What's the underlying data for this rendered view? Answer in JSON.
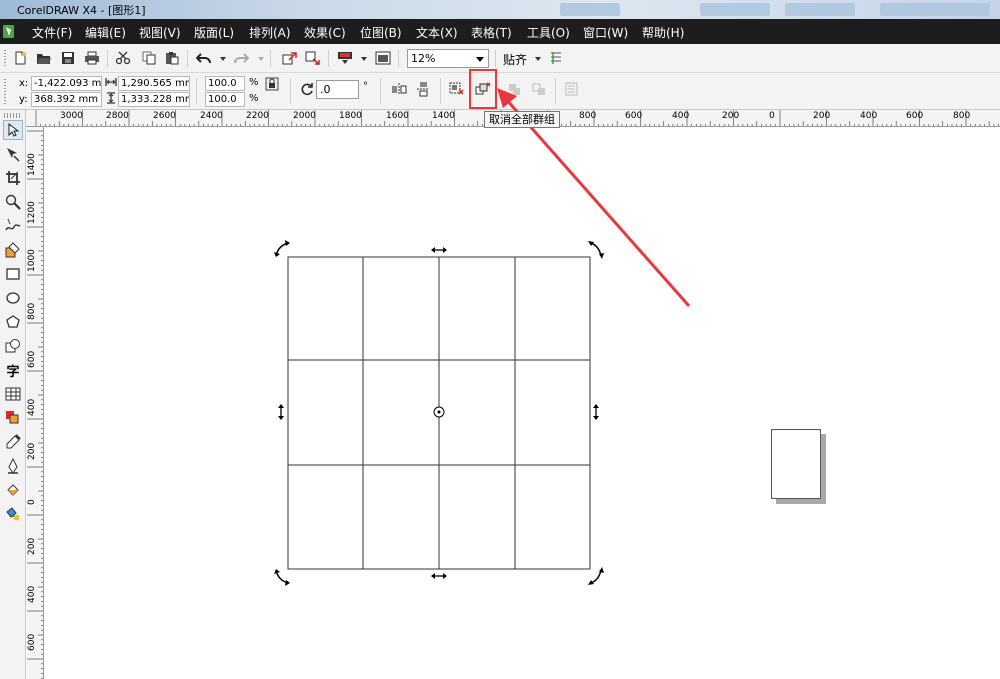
{
  "window": {
    "title": "CorelDRAW X4 - [图形1]"
  },
  "menu": [
    {
      "label": "文件(F)"
    },
    {
      "label": "编辑(E)"
    },
    {
      "label": "视图(V)"
    },
    {
      "label": "版面(L)"
    },
    {
      "label": "排列(A)"
    },
    {
      "label": "效果(C)"
    },
    {
      "label": "位图(B)"
    },
    {
      "label": "文本(X)"
    },
    {
      "label": "表格(T)"
    },
    {
      "label": "工具(O)"
    },
    {
      "label": "窗口(W)"
    },
    {
      "label": "帮助(H)"
    }
  ],
  "standard_toolbar": {
    "zoom_value": "12%",
    "snap_label": "贴齐",
    "icons": [
      "new-icon",
      "open-icon",
      "save-icon",
      "print-icon",
      "cut-icon",
      "copy-icon",
      "paste-icon",
      "undo-icon",
      "redo-icon",
      "import-icon",
      "export-icon",
      "application-launcher-icon",
      "welcome-screen-icon",
      "snap-options-icon"
    ]
  },
  "property_bar": {
    "x_label": "x:",
    "x_value": "-1,422.093 mm",
    "y_label": "y:",
    "y_value": "368.392 mm",
    "width_value": "1,290.565 mm",
    "height_value": "1,333.228 mm",
    "scale_x": "100.0",
    "scale_y": "100.0",
    "percent_sign": "%",
    "rotation_value": ".0",
    "degree_sign": "°"
  },
  "tooltip": {
    "text": "取消全部群组"
  },
  "ruler": {
    "h_labels": [
      "3000",
      "2800",
      "2600",
      "2400",
      "2200",
      "2000",
      "1800",
      "1600",
      "1400",
      "800",
      "600",
      "400",
      "200",
      "0",
      "200",
      "400",
      "600",
      "800"
    ],
    "v_labels": [
      "1400",
      "1200",
      "1000",
      "800",
      "600",
      "400",
      "200",
      "0",
      "200",
      "400",
      "600"
    ]
  },
  "toolbox": {
    "tools": [
      "pick-tool-icon",
      "shape-tool-icon",
      "crop-tool-icon",
      "zoom-tool-icon",
      "freehand-tool-icon",
      "smart-fill-tool-icon",
      "rectangle-tool-icon",
      "ellipse-tool-icon",
      "polygon-tool-icon",
      "basic-shapes-tool-icon",
      "text-tool-icon",
      "table-tool-icon",
      "interactive-blend-tool-icon",
      "eyedropper-tool-icon",
      "outline-tool-icon",
      "fill-tool-icon",
      "interactive-fill-tool-icon"
    ]
  },
  "colors": {
    "menubar_bg": "#1d1d1d",
    "highlight": "#e8383c",
    "toolbar_bg": "#f3f3f3"
  },
  "canvas": {
    "grid_rows": 3,
    "grid_cols": 4
  }
}
